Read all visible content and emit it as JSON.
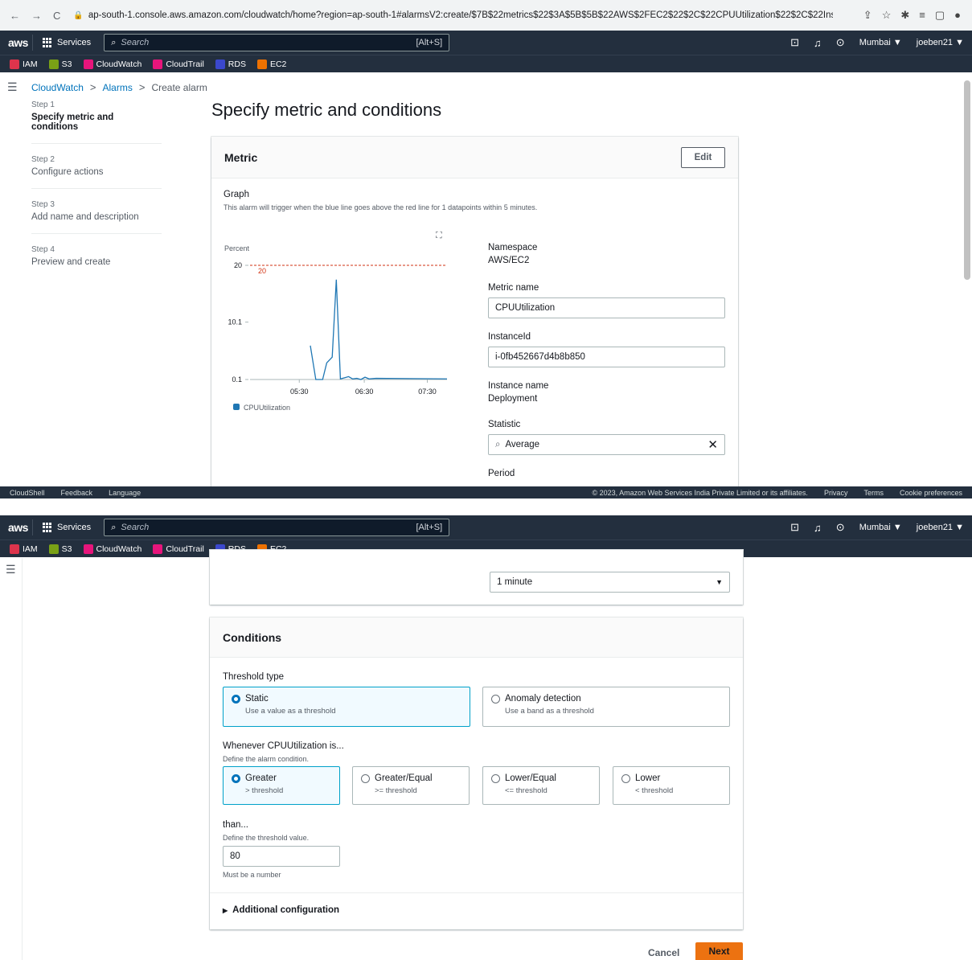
{
  "browser": {
    "url": "ap-south-1.console.aws.amazon.com/cloudwatch/home?region=ap-south-1#alarmsV2:create/$7B$22metrics$22$3A$5B$5B$22AWS$2FEC2$22$2C$22CPUUtilization$22$2C$22InstanceI..."
  },
  "awsnav": {
    "logo": "aws",
    "services": "Services",
    "search_placeholder": "Search",
    "shortcut": "[Alt+S]",
    "region": "Mumbai ▼",
    "user": "joeben21 ▼",
    "favorites": [
      {
        "label": "IAM",
        "color": "#dd344c"
      },
      {
        "label": "S3",
        "color": "#7aa116"
      },
      {
        "label": "CloudWatch",
        "color": "#e7157b"
      },
      {
        "label": "CloudTrail",
        "color": "#e7157b"
      },
      {
        "label": "RDS",
        "color": "#3b48cc"
      },
      {
        "label": "EC2",
        "color": "#ed7100"
      }
    ]
  },
  "breadcrumb": {
    "a": "CloudWatch",
    "b": "Alarms",
    "c": "Create alarm"
  },
  "steps": [
    {
      "num": "Step 1",
      "label": "Specify metric and conditions"
    },
    {
      "num": "Step 2",
      "label": "Configure actions"
    },
    {
      "num": "Step 3",
      "label": "Add name and description"
    },
    {
      "num": "Step 4",
      "label": "Preview and create"
    }
  ],
  "page_title": "Specify metric and conditions",
  "metric": {
    "title": "Metric",
    "edit": "Edit",
    "graph_label": "Graph",
    "graph_desc": "This alarm will trigger when the blue line goes above the red line for 1 datapoints within 5 minutes.",
    "namespace_label": "Namespace",
    "namespace": "AWS/EC2",
    "metric_name_label": "Metric name",
    "metric_name": "CPUUtilization",
    "instance_id_label": "InstanceId",
    "instance_id": "i-0fb452667d4b8b850",
    "instance_name_label": "Instance name",
    "instance_name": "Deployment",
    "statistic_label": "Statistic",
    "statistic": "Average",
    "period_label": "Period",
    "period": "1 minute"
  },
  "chart_data": {
    "type": "line",
    "ylabel": "Percent",
    "yticks": [
      "20",
      "10.1",
      "0.1"
    ],
    "ylim": [
      0.1,
      20
    ],
    "xticks": [
      "05:30",
      "06:30",
      "07:30"
    ],
    "threshold": 20,
    "threshold_label": "20",
    "series": [
      {
        "name": "CPUUtilization",
        "color": "#1f77b4",
        "points": [
          [
            0,
            6.0
          ],
          [
            0.04,
            0.1
          ],
          [
            0.09,
            0.1
          ],
          [
            0.12,
            3.0
          ],
          [
            0.16,
            4.0
          ],
          [
            0.19,
            17.5
          ],
          [
            0.22,
            0.2
          ],
          [
            0.25,
            0.4
          ],
          [
            0.28,
            0.6
          ],
          [
            0.31,
            0.2
          ],
          [
            0.34,
            0.3
          ],
          [
            0.37,
            0.1
          ],
          [
            0.4,
            0.5
          ],
          [
            0.43,
            0.2
          ],
          [
            0.48,
            0.3
          ],
          [
            1.0,
            0.2
          ]
        ]
      }
    ]
  },
  "conditions": {
    "title": "Conditions",
    "threshold_type_label": "Threshold type",
    "static_label": "Static",
    "static_desc": "Use a value as a threshold",
    "anomaly_label": "Anomaly detection",
    "anomaly_desc": "Use a band as a threshold",
    "whenever_label": "Whenever CPUUtilization is...",
    "whenever_desc": "Define the alarm condition.",
    "options": [
      {
        "label": "Greater",
        "desc": "> threshold"
      },
      {
        "label": "Greater/Equal",
        "desc": ">= threshold"
      },
      {
        "label": "Lower/Equal",
        "desc": "<= threshold"
      },
      {
        "label": "Lower",
        "desc": "< threshold"
      }
    ],
    "than_label": "than...",
    "than_desc": "Define the threshold value.",
    "threshold_value": "80",
    "hint": "Must be a number",
    "additional": "Additional configuration"
  },
  "actions": {
    "cancel": "Cancel",
    "next": "Next"
  },
  "footer": {
    "cloudshell": "CloudShell",
    "feedback": "Feedback",
    "language": "Language",
    "copyright": "© 2023, Amazon Web Services India Private Limited or its affiliates.",
    "privacy": "Privacy",
    "terms": "Terms",
    "cookie": "Cookie preferences"
  }
}
